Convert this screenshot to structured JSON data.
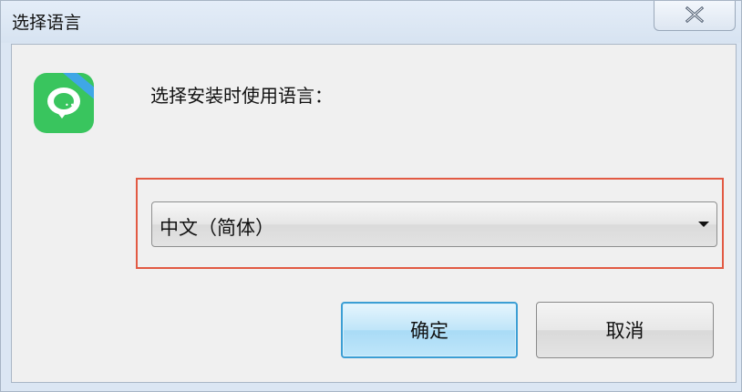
{
  "window": {
    "title": "选择语言"
  },
  "dialog": {
    "prompt": "选择安装时使用语言：",
    "language_select": {
      "selected": "中文（简体）"
    },
    "buttons": {
      "ok_label": "确定",
      "cancel_label": "取消"
    }
  },
  "colors": {
    "highlight_border": "#e25a43",
    "app_icon_green": "#39c55e",
    "ok_button_border": "#3c9ed4"
  },
  "icons": {
    "app": "chat-bubble-app-icon",
    "close": "close-icon",
    "dropdown": "chevron-down-icon"
  }
}
